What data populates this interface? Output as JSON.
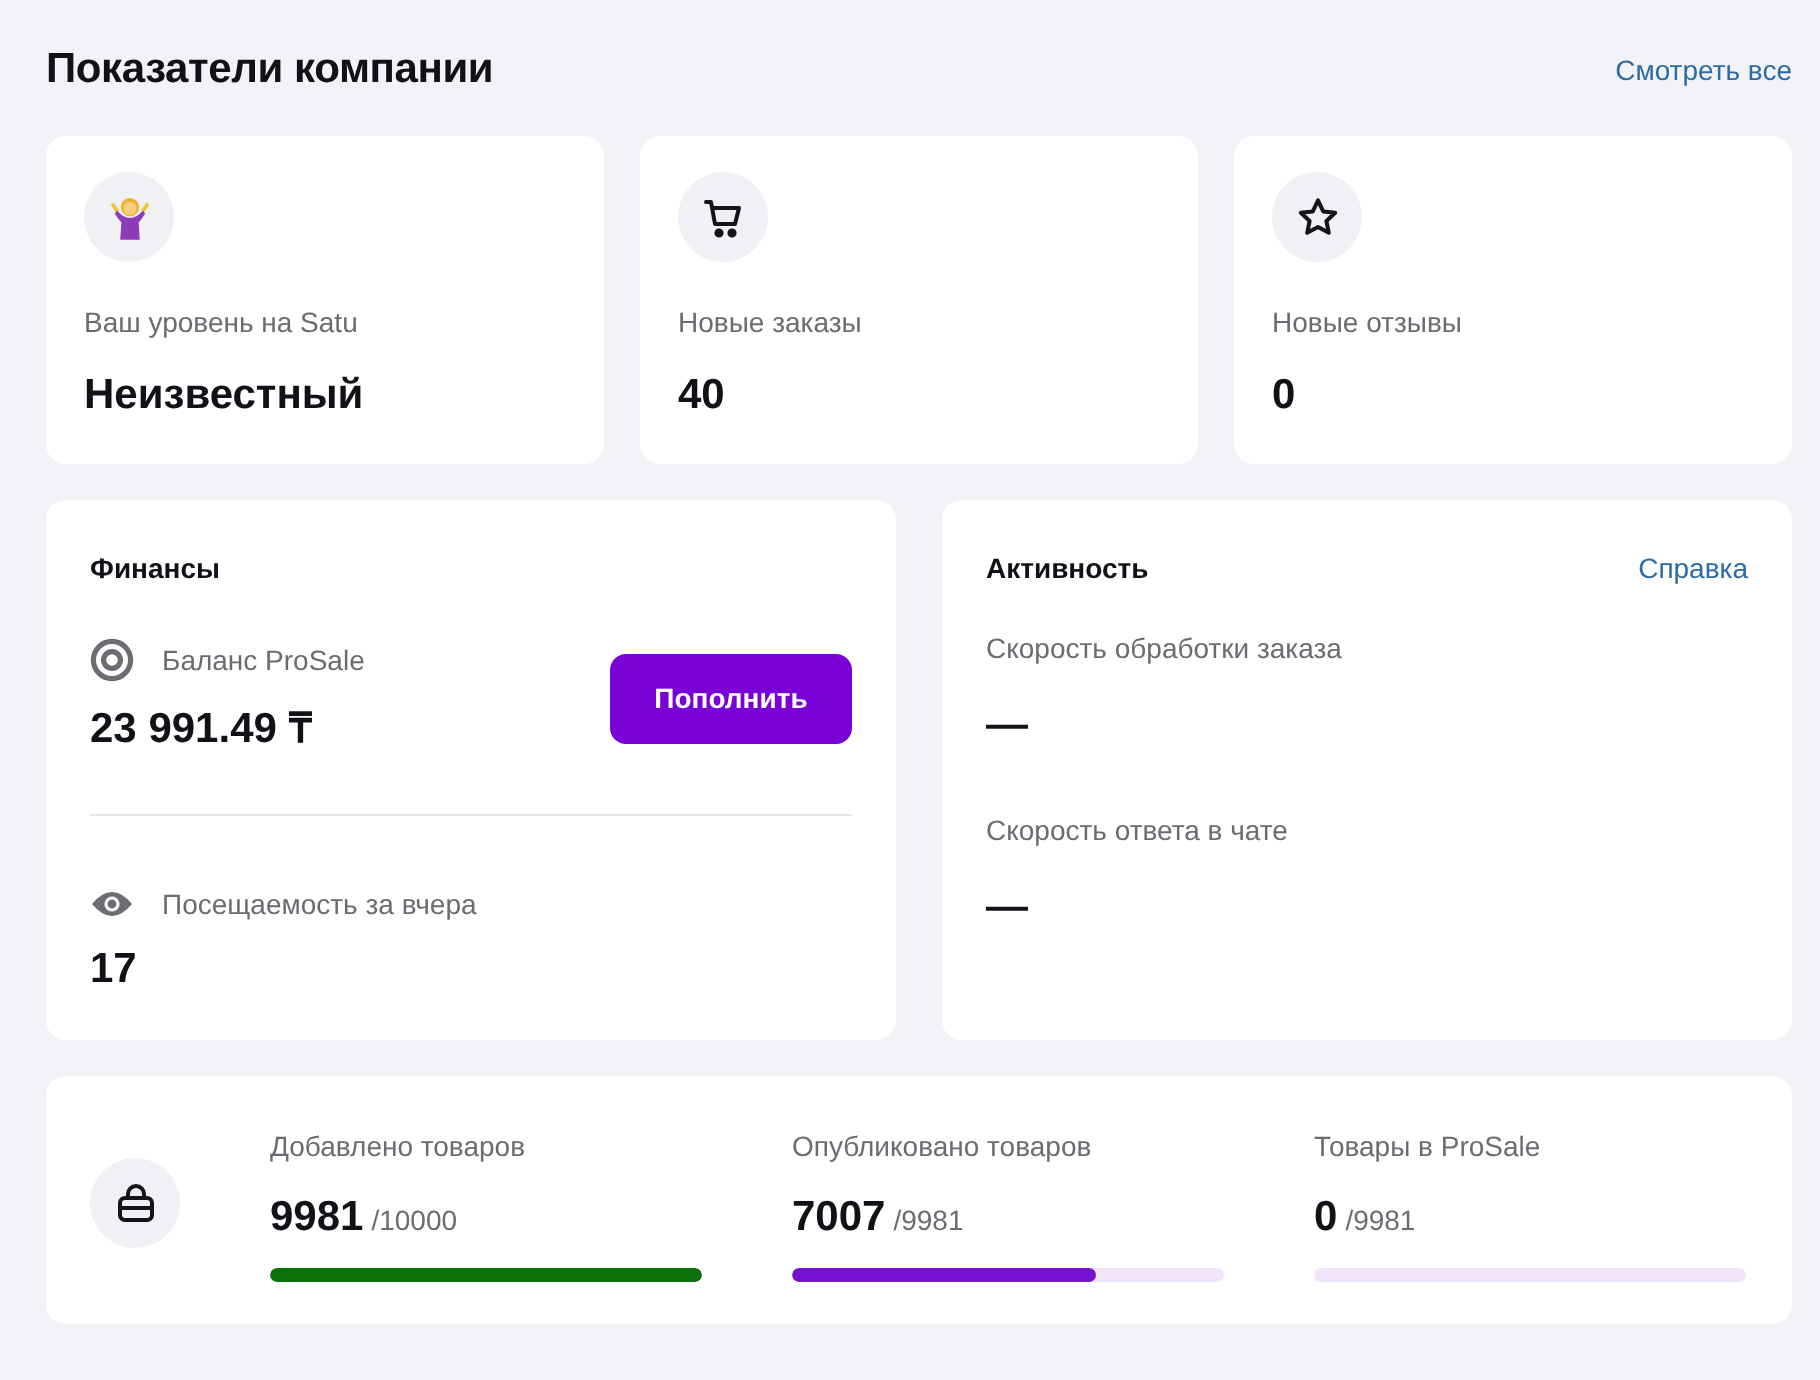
{
  "header": {
    "title": "Показатели компании",
    "link": "Смотреть все"
  },
  "summary_cards": [
    {
      "label": "Ваш уровень на Satu",
      "value": "Неизвестный"
    },
    {
      "label": "Новые заказы",
      "value": "40"
    },
    {
      "label": "Новые отзывы",
      "value": "0"
    }
  ],
  "finances": {
    "title": "Финансы",
    "balance": {
      "label": "Баланс ProSale",
      "value": "23 991.49 ₸",
      "button": "Пополнить"
    },
    "visits": {
      "label": "Посещаемость за вчера",
      "value": "17"
    }
  },
  "activity": {
    "title": "Активность",
    "link": "Справка",
    "metrics": [
      {
        "label": "Скорость обработки заказа",
        "value": "—"
      },
      {
        "label": "Скорость ответа в чате",
        "value": "—"
      }
    ]
  },
  "products": [
    {
      "label": "Добавлено товаров",
      "value": "9981",
      "total": "/10000",
      "level": 0.9981,
      "color": "#0b720b"
    },
    {
      "label": "Опубликовано товаров",
      "value": "7007",
      "total": "/9981",
      "level": 0.702,
      "color": "#7412d1"
    },
    {
      "label": "Товары в ProSale",
      "value": "0",
      "total": "/9981"
    }
  ]
}
